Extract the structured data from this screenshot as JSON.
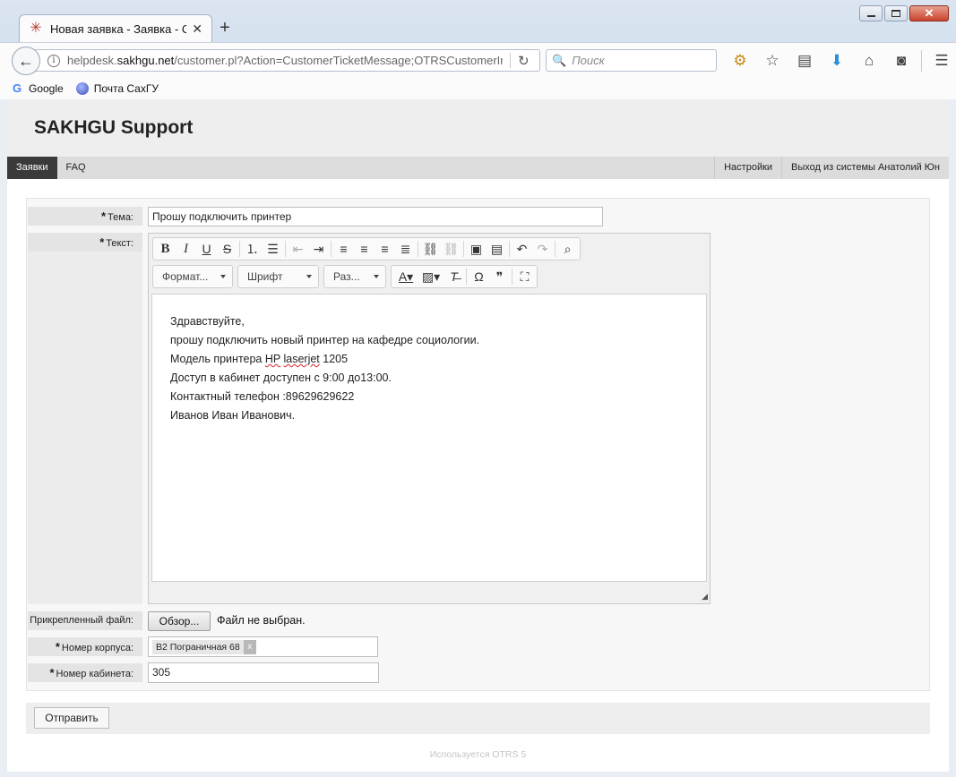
{
  "browser": {
    "tab_title": "Новая заявка - Заявка - О...",
    "url_prefix": "helpdesk.",
    "url_domain": "sakhgu.net",
    "url_path": "/customer.pl?Action=CustomerTicketMessage;OTRSCustomerInterf",
    "search_placeholder": "Поиск",
    "bookmarks": [
      {
        "label": "Google",
        "icon": "google-icon"
      },
      {
        "label": "Почта СахГУ",
        "icon": "globe-icon"
      }
    ]
  },
  "header": {
    "title": "SAKHGU Support"
  },
  "menu": {
    "items": [
      "Заявки",
      "FAQ"
    ],
    "settings": "Настройки",
    "logout": "Выход из системы Анатолий Юн"
  },
  "form": {
    "subject_label": "Тема:",
    "subject_value": "Прошу подключить принтер",
    "text_label": "Текст:",
    "format_combo": "Формат...",
    "font_combo": "Шрифт",
    "size_combo": "Раз...",
    "body_lines": [
      "Здравствуйте,",
      "прошу подключить новый принтер на кафедре социологии.",
      "Модель принтера ",
      "Доступ в кабинет доступен с 9:00 до13:00.",
      "Контактный телефон :89629629622",
      "Иванов Иван Иванович."
    ],
    "printer_brand": "HP",
    "printer_model": "laserjet",
    "printer_number": " 1205",
    "attachment_label": "Прикрепленный файл:",
    "browse_button": "Обзор...",
    "no_file": "Файл не выбран.",
    "building_label": "Номер корпуса:",
    "building_value": "В2 Пограничная 68",
    "building_remove": "x",
    "room_label": "Номер кабинета:",
    "room_value": "305",
    "submit": "Отправить"
  },
  "footer": "Используется OTRS 5"
}
